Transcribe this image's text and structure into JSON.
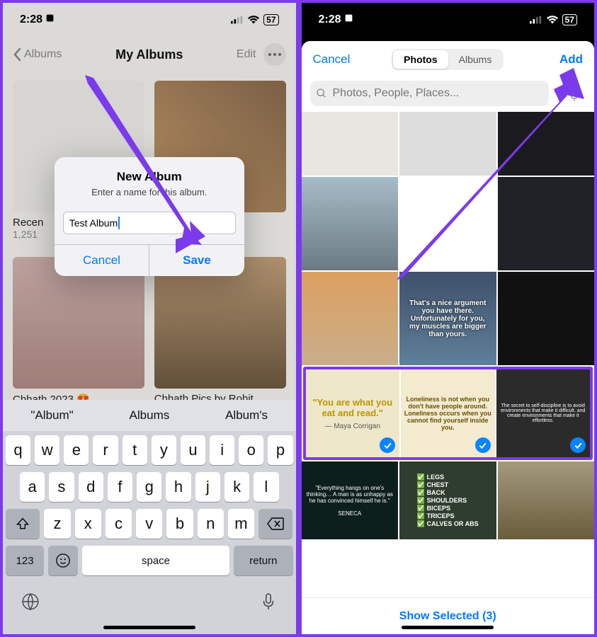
{
  "left": {
    "status": {
      "time": "2:28",
      "battery": "57"
    },
    "nav": {
      "back": "Albums",
      "title": "My Albums",
      "edit": "Edit"
    },
    "albums": [
      {
        "name": "Recen",
        "count": "1,251"
      },
      {
        "name": ""
      },
      {
        "name": "Chhath 2023 😍"
      },
      {
        "name": "Chhath Pics by Rohit"
      }
    ],
    "alert": {
      "title": "New Album",
      "message": "Enter a name for this album.",
      "input_value": "Test Album",
      "cancel": "Cancel",
      "save": "Save"
    },
    "kb": {
      "suggestions": [
        "\"Album\"",
        "Albums",
        "Album's"
      ],
      "rows": [
        [
          "q",
          "w",
          "e",
          "r",
          "t",
          "y",
          "u",
          "i",
          "o",
          "p"
        ],
        [
          "a",
          "s",
          "d",
          "f",
          "g",
          "h",
          "j",
          "k",
          "l"
        ],
        [
          "z",
          "x",
          "c",
          "v",
          "b",
          "n",
          "m"
        ]
      ],
      "num_label": "123",
      "space_label": "space",
      "return_label": "return"
    }
  },
  "right": {
    "status": {
      "time": "2:28",
      "battery": "57"
    },
    "head": {
      "cancel": "Cancel",
      "add": "Add"
    },
    "segment": {
      "photos": "Photos",
      "albums": "Albums"
    },
    "search": {
      "placeholder": "Photos, People, Places..."
    },
    "selected_row": [
      {
        "quote": "\"You are what you eat and read.\"",
        "by": "— Maya Corrigan"
      },
      {
        "quote": "Loneliness is not when you don't have people around. Loneliness occurs when you cannot find yourself inside you."
      },
      {
        "quote": "The secret to self-discipline is to avoid environments that make it difficult, and create environments that make it effortless."
      }
    ],
    "footer": "Show Selected (3)"
  }
}
